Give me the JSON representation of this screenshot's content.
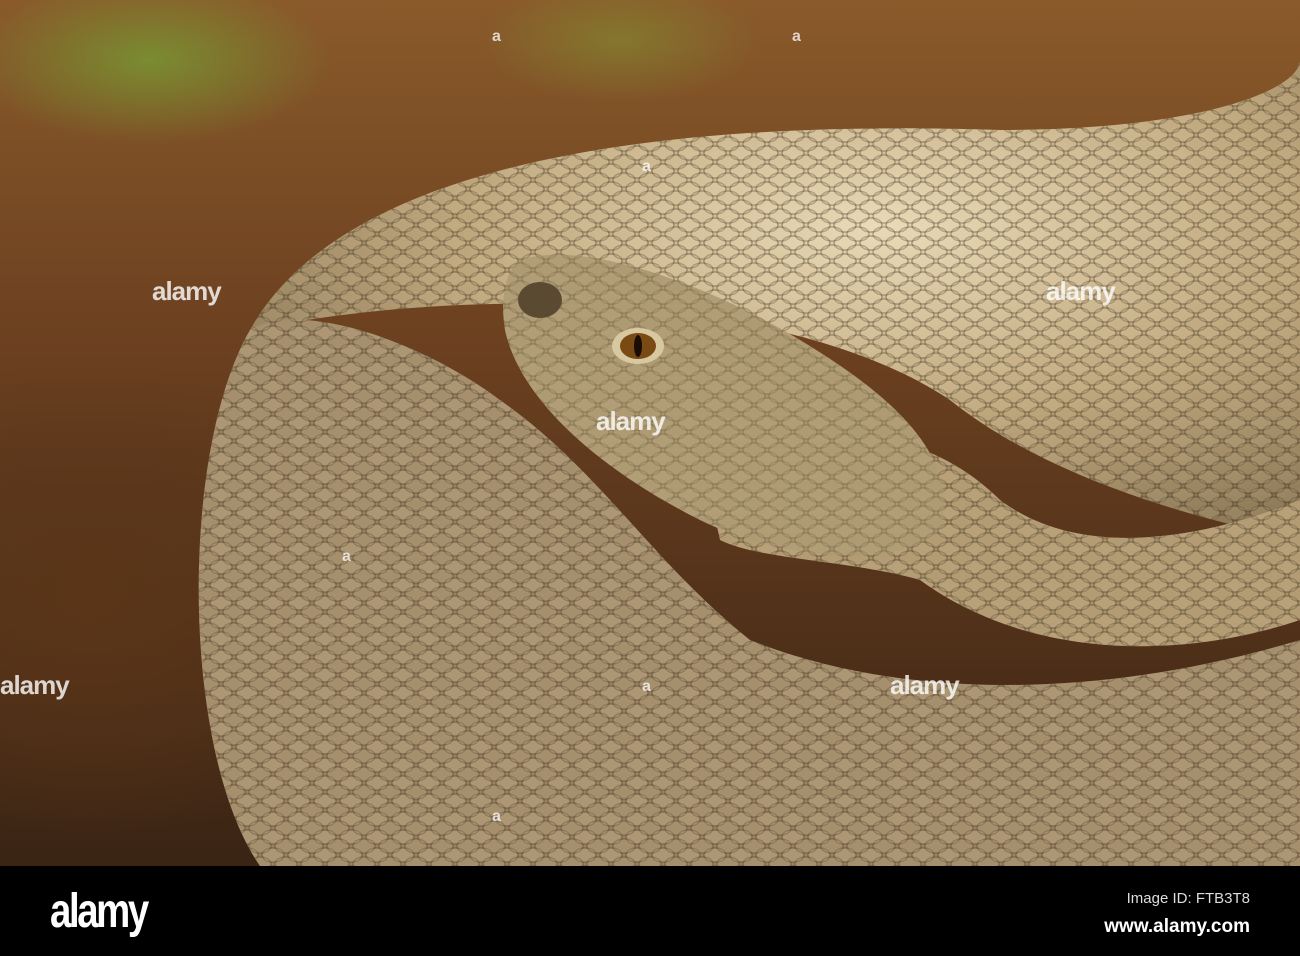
{
  "watermark": {
    "text": "alamy",
    "small_mark": "a"
  },
  "footer": {
    "logo": "alamy",
    "image_id": "Image ID: FTB3T8",
    "url": "www.alamy.com"
  }
}
